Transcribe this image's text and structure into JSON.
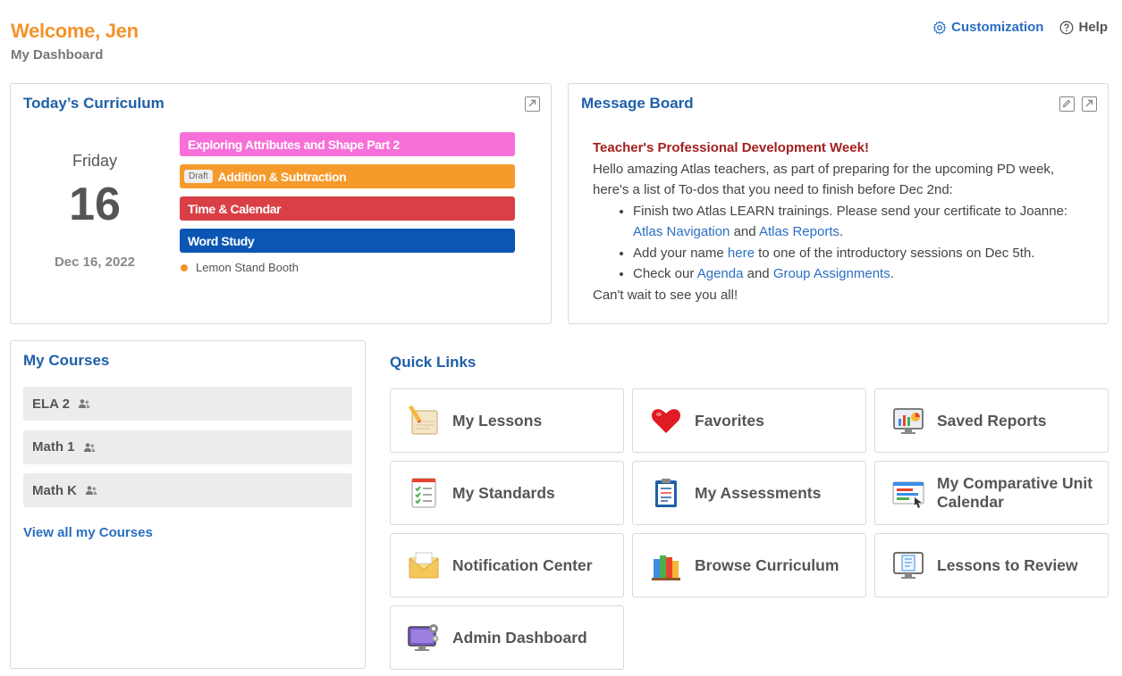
{
  "header": {
    "welcome": "Welcome, Jen",
    "subtitle": "My Dashboard",
    "customization": "Customization",
    "help": "Help"
  },
  "curriculum": {
    "title": "Today’s Curriculum",
    "day_name": "Friday",
    "day_number": "16",
    "full_date": "Dec 16, 2022",
    "lessons": [
      {
        "label": "Exploring Attributes and Shape Part 2",
        "color": "#f76fd8",
        "draft": ""
      },
      {
        "label": "Addition & Subtraction",
        "color": "#f59a2b",
        "draft": "Draft"
      },
      {
        "label": "Time & Calendar",
        "color": "#d93f44",
        "draft": ""
      },
      {
        "label": "Word Study",
        "color": "#0b56b3",
        "draft": ""
      }
    ],
    "event": "Lemon Stand Booth"
  },
  "message_board": {
    "title": "Message Board",
    "heading": "Teacher's Professional Development Week!",
    "intro": "Hello amazing Atlas teachers, as part of preparing for the upcoming PD week, here's a list of To-dos that you need to finish before Dec 2nd:",
    "item1_text": "Finish two Atlas LEARN trainings. Please send your certificate to Joanne:",
    "item1_link1": "Atlas Navigation",
    "item1_and": "and",
    "item1_link2": "Atlas Reports",
    "item2_pre": "Add your name",
    "item2_link": "here",
    "item2_post": "to one of the introductory sessions on Dec 5th.",
    "item3_pre": "Check our",
    "item3_link1": "Agenda",
    "item3_and": "and",
    "item3_link2": "Group Assignments",
    "closing": "Can't wait to see you all!"
  },
  "courses": {
    "title": "My Courses",
    "items": [
      {
        "label": "ELA 2"
      },
      {
        "label": "Math 1"
      },
      {
        "label": "Math K"
      }
    ],
    "view_all": "View all my Courses"
  },
  "quick_links": {
    "title": "Quick Links",
    "items": [
      {
        "label": "My Lessons",
        "icon": "lesson-planning-icon"
      },
      {
        "label": "Favorites",
        "icon": "heart-icon"
      },
      {
        "label": "Saved Reports",
        "icon": "reports-monitor-icon"
      },
      {
        "label": "My Standards",
        "icon": "checklist-icon"
      },
      {
        "label": "My Assessments",
        "icon": "clipboard-icon"
      },
      {
        "label": "My Comparative Unit Calendar",
        "icon": "calendar-window-icon"
      },
      {
        "label": "Notification Center",
        "icon": "envelope-icon"
      },
      {
        "label": "Browse Curriculum",
        "icon": "books-icon"
      },
      {
        "label": "Lessons to Review",
        "icon": "review-monitor-icon"
      },
      {
        "label": "Admin Dashboard",
        "icon": "admin-monitor-icon"
      }
    ]
  }
}
